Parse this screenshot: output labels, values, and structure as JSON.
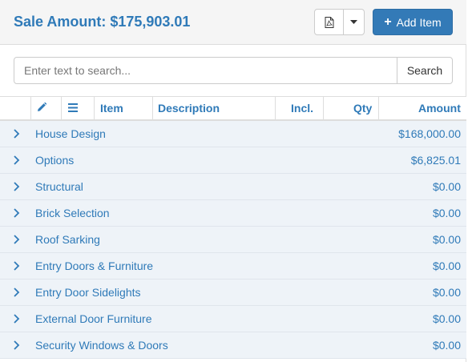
{
  "header": {
    "title": "Sale Amount: $175,903.01",
    "add_item_label": "Add Item",
    "pdf_icon": "pdf-file-icon",
    "caret_icon": "caret-down-icon",
    "plus_icon": "plus-icon"
  },
  "search": {
    "placeholder": "Enter text to search...",
    "value": "",
    "button_label": "Search"
  },
  "table": {
    "columns": {
      "edit_icon": "pencil-icon",
      "menu_icon": "list-icon",
      "item": "Item",
      "description": "Description",
      "incl": "Incl.",
      "qty": "Qty",
      "amount": "Amount"
    },
    "rows": [
      {
        "label": "House Design",
        "amount": "$168,000.00"
      },
      {
        "label": "Options",
        "amount": "$6,825.01"
      },
      {
        "label": "Structural",
        "amount": "$0.00"
      },
      {
        "label": "Brick Selection",
        "amount": "$0.00"
      },
      {
        "label": "Roof Sarking",
        "amount": "$0.00"
      },
      {
        "label": "Entry Doors & Furniture",
        "amount": "$0.00"
      },
      {
        "label": "Entry Door Sidelights",
        "amount": "$0.00"
      },
      {
        "label": "External Door Furniture",
        "amount": "$0.00"
      },
      {
        "label": "Security Windows & Doors",
        "amount": "$0.00"
      }
    ]
  },
  "colors": {
    "accent": "#2f7ab8",
    "primary_button": "#337ab7",
    "row_background": "#eef3f8",
    "header_background": "#f5f5f5"
  }
}
